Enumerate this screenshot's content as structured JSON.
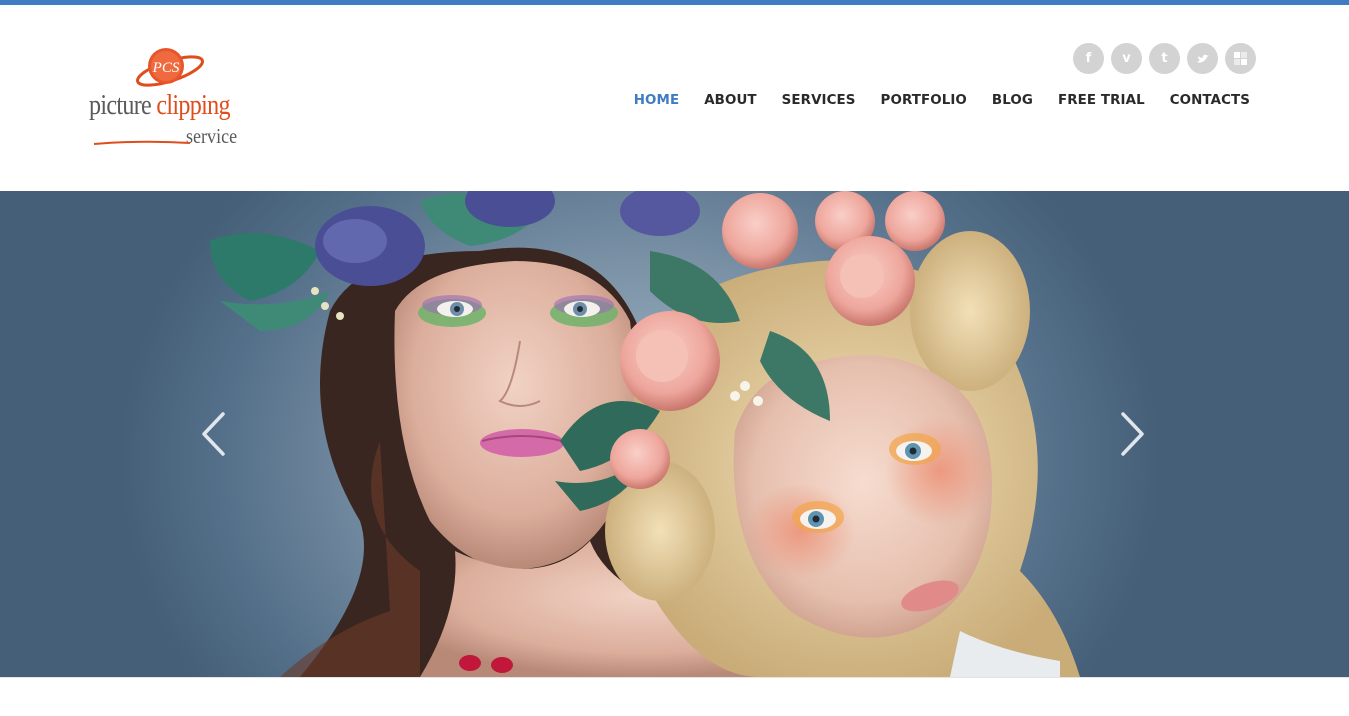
{
  "brand": {
    "mark_text": "PCS",
    "name_part1": "picture",
    "name_part2": "clipping",
    "name_part3": "service",
    "accent_color": "#e04d1c",
    "text_color": "#5a5a5a"
  },
  "theme": {
    "top_strip_color": "#3f7cc4",
    "nav_active_color": "#3f7cc4",
    "nav_color": "#2a2a2a",
    "social_bg": "#d3d3d3"
  },
  "social": [
    {
      "icon": "facebook-icon",
      "glyph": "f"
    },
    {
      "icon": "vimeo-icon",
      "glyph": "v"
    },
    {
      "icon": "tumblr-icon",
      "glyph": "t"
    },
    {
      "icon": "twitter-icon",
      "glyph": "❧"
    },
    {
      "icon": "delicious-icon",
      "glyph": "▣"
    }
  ],
  "nav": {
    "items": [
      {
        "label": "HOME",
        "active": true
      },
      {
        "label": "ABOUT",
        "active": false
      },
      {
        "label": "SERVICES",
        "active": false
      },
      {
        "label": "PORTFOLIO",
        "active": false
      },
      {
        "label": "BLOG",
        "active": false
      },
      {
        "label": "FREE TRIAL",
        "active": false
      },
      {
        "label": "CONTACTS",
        "active": false
      }
    ]
  },
  "slider": {
    "prev_icon": "chevron-left-icon",
    "next_icon": "chevron-right-icon",
    "image": "hero-slide-image"
  }
}
